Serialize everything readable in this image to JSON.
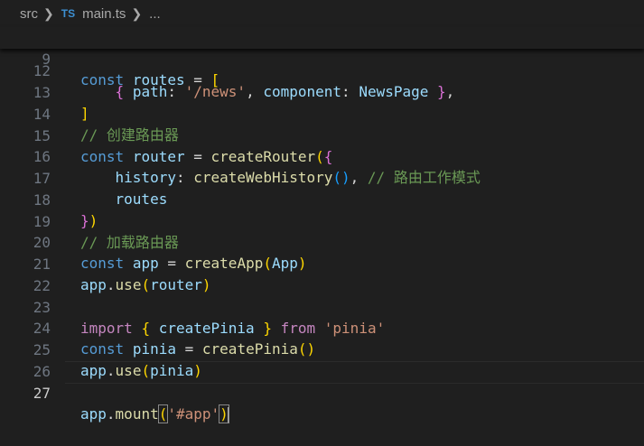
{
  "breadcrumb": {
    "folder": "src",
    "file_icon": "TS",
    "file": "main.ts",
    "more": "..."
  },
  "editor": {
    "sticky_line": {
      "number": "9",
      "text": "const routes = ["
    },
    "lines": [
      {
        "number": "12",
        "text": "    { path: '/news', component: NewsPage },"
      },
      {
        "number": "13",
        "text": "]"
      },
      {
        "number": "14",
        "text": "// 创建路由器"
      },
      {
        "number": "15",
        "text": "const router = createRouter({"
      },
      {
        "number": "16",
        "text": "    history: createWebHistory(), // 路由工作模式"
      },
      {
        "number": "17",
        "text": "    routes"
      },
      {
        "number": "18",
        "text": "})"
      },
      {
        "number": "19",
        "text": "// 加载路由器"
      },
      {
        "number": "20",
        "text": "const app = createApp(App)"
      },
      {
        "number": "21",
        "text": "app.use(router)"
      },
      {
        "number": "22",
        "text": ""
      },
      {
        "number": "23",
        "text": "import { createPinia } from 'pinia'"
      },
      {
        "number": "24",
        "text": "const pinia = createPinia()"
      },
      {
        "number": "25",
        "text": "app.use(pinia)"
      },
      {
        "number": "26",
        "text": ""
      },
      {
        "number": "27",
        "text": "app.mount('#app')"
      }
    ],
    "active_line": "27"
  },
  "colors": {
    "background": "#1f1f1f",
    "keyword": "#569cd6",
    "control_keyword": "#c586c0",
    "variable": "#9cdcfe",
    "function": "#dcdcaa",
    "string": "#ce9178",
    "comment": "#6a9955",
    "bracket_level1": "#ffd700",
    "bracket_level2": "#da70d6",
    "bracket_level3": "#179fff"
  }
}
